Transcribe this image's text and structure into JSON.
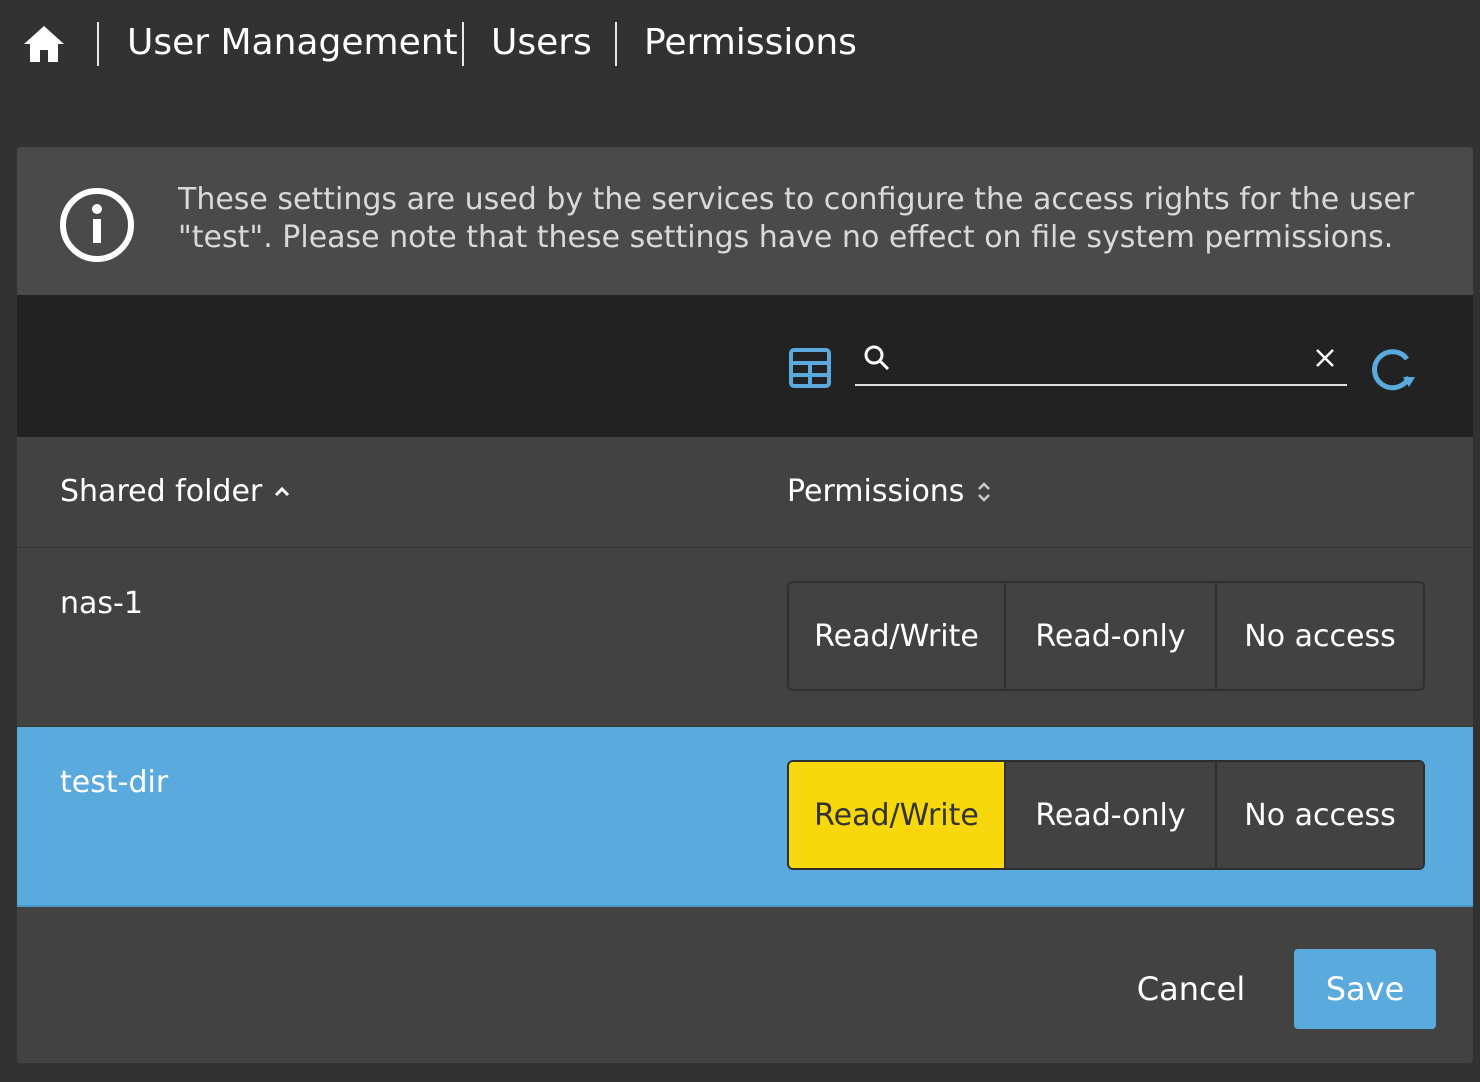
{
  "breadcrumb": {
    "home_icon": "home-icon",
    "items": [
      "User Management",
      "Users",
      "Permissions"
    ]
  },
  "info": {
    "icon": "info-circle-icon",
    "text": "These settings are used by the services to configure the access rights for the user \"test\". Please note that these settings have no effect on file system permissions."
  },
  "toolbar": {
    "grid_icon": "table-grid-icon",
    "search_icon": "search-icon",
    "search_value": "",
    "clear_icon": "close-icon",
    "refresh_icon": "refresh-icon",
    "accent_color": "#5aaade"
  },
  "table": {
    "columns": [
      {
        "label": "Shared folder",
        "sort": "ascending"
      },
      {
        "label": "Permissions",
        "sort": "unsorted"
      }
    ],
    "permission_options": [
      "Read/Write",
      "Read-only",
      "No access"
    ],
    "rows": [
      {
        "name": "nas-1",
        "selected": false,
        "permission": ""
      },
      {
        "name": "test-dir",
        "selected": true,
        "permission": "Read/Write"
      }
    ],
    "selected_row_color": "#5aaade",
    "active_option_color": "#f7d80c"
  },
  "footer": {
    "cancel_label": "Cancel",
    "save_label": "Save"
  }
}
